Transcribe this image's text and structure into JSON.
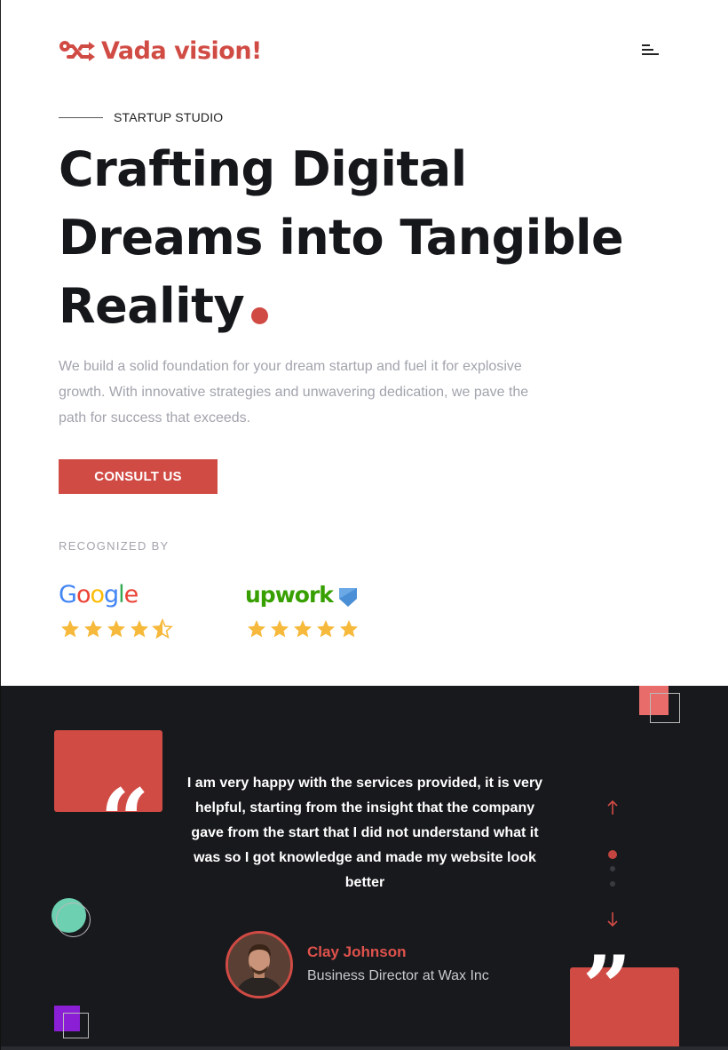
{
  "colors": {
    "accent": "#d14b45",
    "dark_bg": "#18191d",
    "heading": "#16171b",
    "muted": "#a2a4ad"
  },
  "header": {
    "logo_text": "Vada vision!",
    "logo_icon": "infinity-arrows-icon",
    "menu_icon": "hamburger-menu-icon"
  },
  "hero": {
    "eyebrow": "STARTUP STUDIO",
    "headline_line1": "Crafting Digital",
    "headline_line2": "Dreams into Tangible",
    "headline_line3": "Reality",
    "lead": "We build a solid foundation for your dream startup and fuel it for explosive growth. With innovative strategies and unwavering dedication, we pave the path for success that exceeds.",
    "cta_label": "CONSULT US"
  },
  "recognized": {
    "label": "RECOGNIZED BY",
    "brands": [
      {
        "name": "Google",
        "rating": 4.5
      },
      {
        "name": "upwork",
        "rating": 5
      }
    ]
  },
  "testimonial": {
    "quote": "I am very happy with the services provided, it is very helpful, starting from the insight that the company gave from the start that I did not understand what it was so I got knowledge and made my website look better",
    "open_quote": "“",
    "close_quote": "”",
    "author_name": "Clay Johnson",
    "author_role": "Business Director at Wax Inc",
    "pager": {
      "current": 1,
      "total": 3
    }
  }
}
